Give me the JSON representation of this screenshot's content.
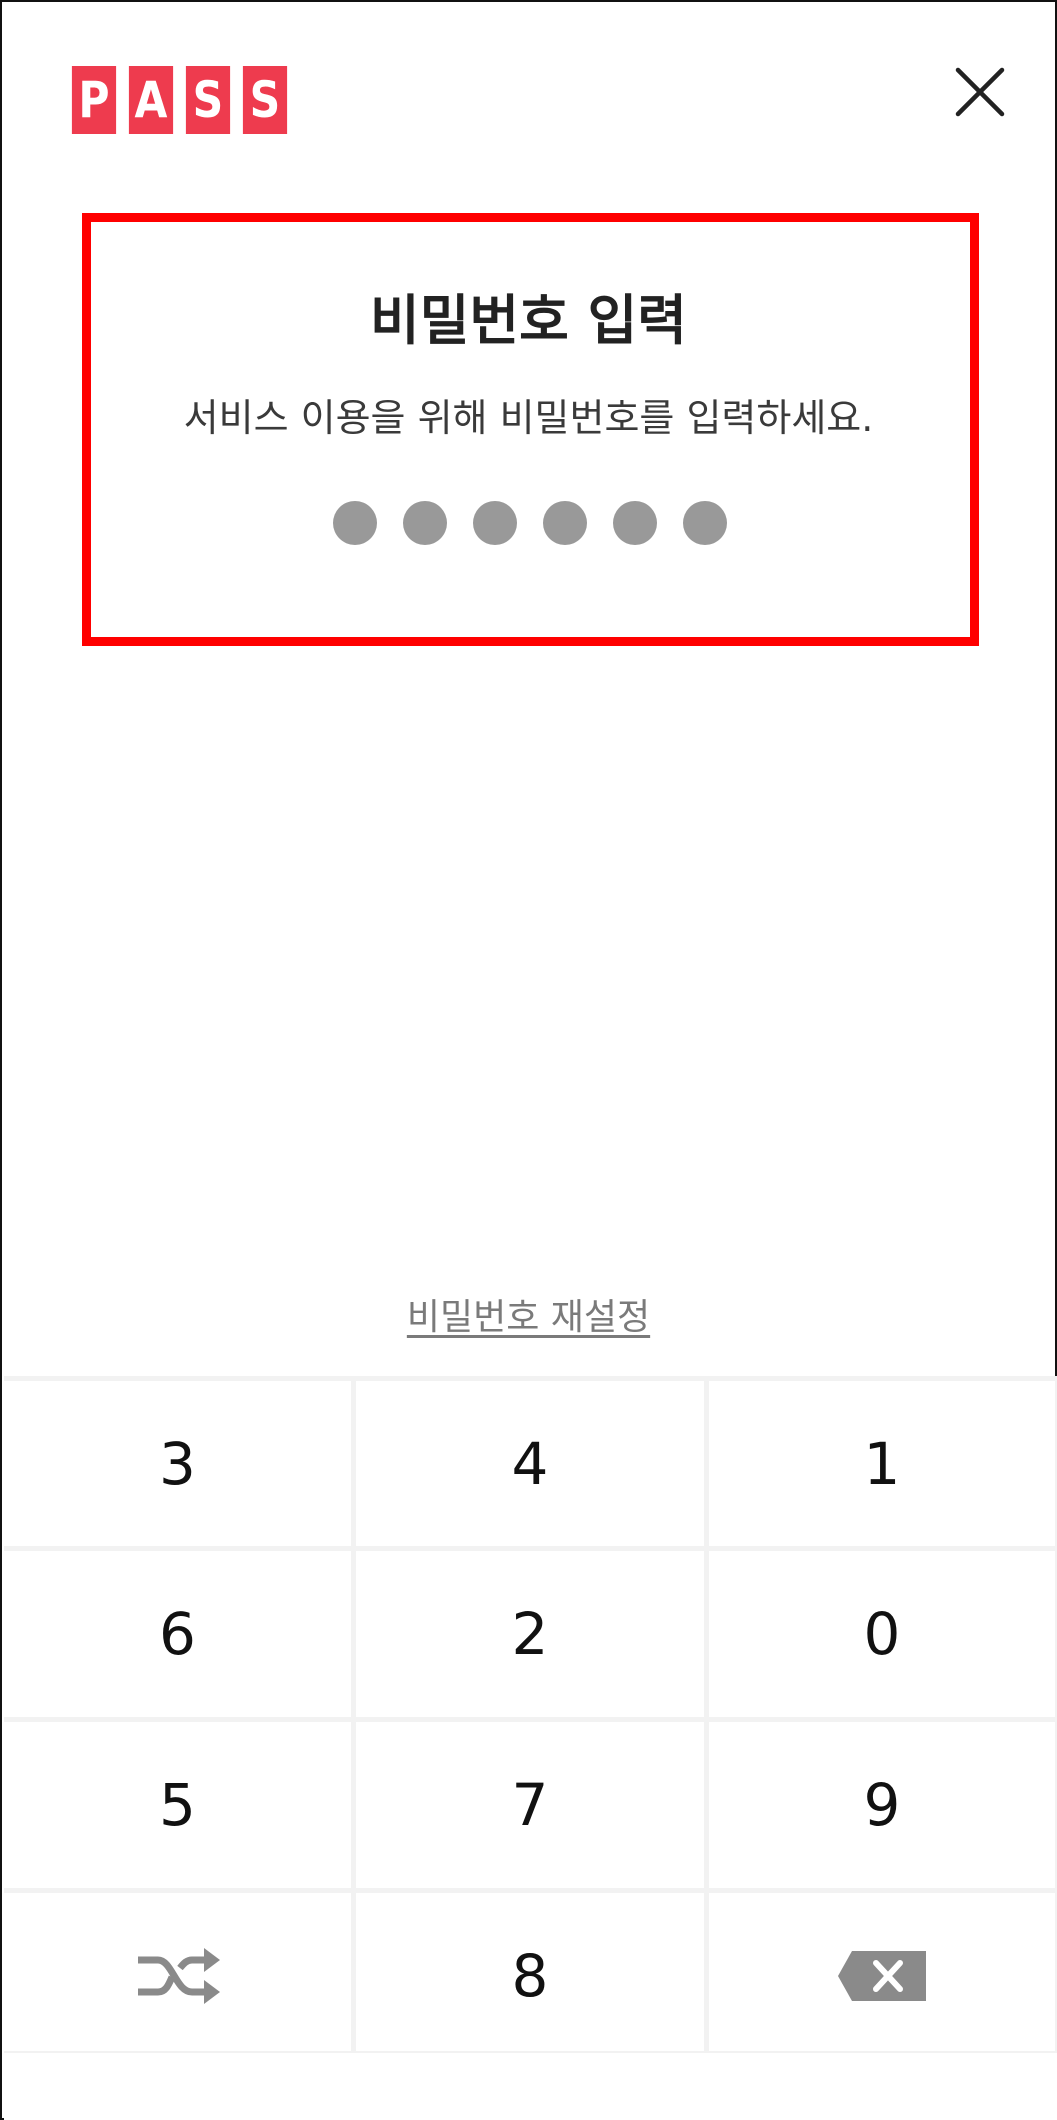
{
  "header": {
    "logo_letters": [
      "P",
      "A",
      "S",
      "S"
    ],
    "brand_color": "#ee3b4e",
    "close_icon": "close-icon"
  },
  "prompt": {
    "title": "비밀번호 입력",
    "subtitle": "서비스 이용을 위해 비밀번호를 입력하세요.",
    "pin_length": 6,
    "highlight_color": "#ff0000"
  },
  "reset_link": "비밀번호 재설정",
  "keypad": {
    "keys": [
      "3",
      "4",
      "1",
      "6",
      "2",
      "0",
      "5",
      "7",
      "9",
      "shuffle-icon",
      "8",
      "backspace-icon"
    ]
  }
}
